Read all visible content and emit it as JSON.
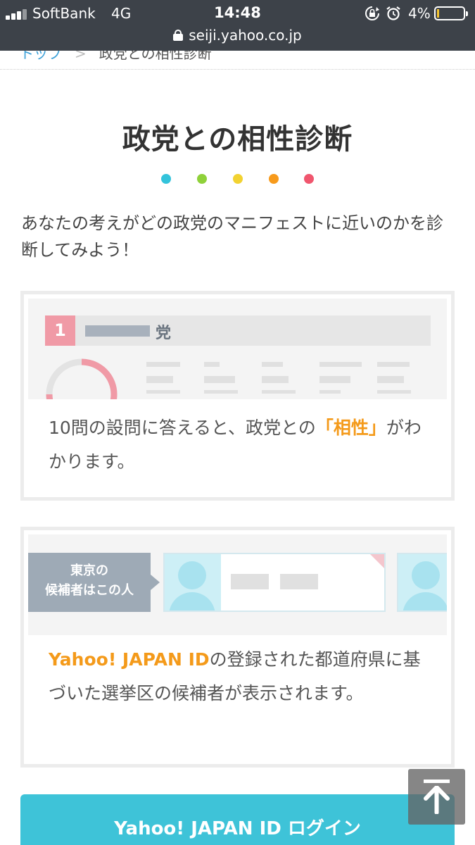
{
  "status_bar": {
    "carrier": "SoftBank",
    "network": "4G",
    "time": "14:48",
    "battery_percent": "4%",
    "battery_level": 0.04,
    "url": "seiji.yahoo.co.jp",
    "icons": [
      "signal-icon",
      "rotation-lock-icon",
      "alarm-icon",
      "battery-icon",
      "padlock-icon"
    ]
  },
  "breadcrumb": {
    "home": "トップ",
    "separator": ">",
    "current": "政党との相性診断"
  },
  "page": {
    "title": "政党との相性診断",
    "dot_colors": [
      "#33c3db",
      "#8fd13a",
      "#f2d231",
      "#f79a1b",
      "#f0566e"
    ],
    "intro": "あなたの考えがどの政党のマニフェストに近いのかを診断してみよう！"
  },
  "card1": {
    "rank_number": "1",
    "party_suffix": "党",
    "text_before": "10問の設問に答えると、政党との",
    "text_highlight": "「相性」",
    "text_after": "がわかります。"
  },
  "card2": {
    "region_tag_line1": "東京の",
    "region_tag_line2": "候補者はこの人",
    "text_highlight": "Yahoo! JAPAN ID",
    "text_after": "の登録された都道府県に基づいた選挙区の候補者が表示されます。"
  },
  "login_button": "Yahoo! JAPAN ID ログイン",
  "colors": {
    "status_bg": "#3d4249",
    "accent_orange": "#f49a1a",
    "login_blue": "#3ec3d8",
    "rank_pink": "#f09aa6"
  }
}
